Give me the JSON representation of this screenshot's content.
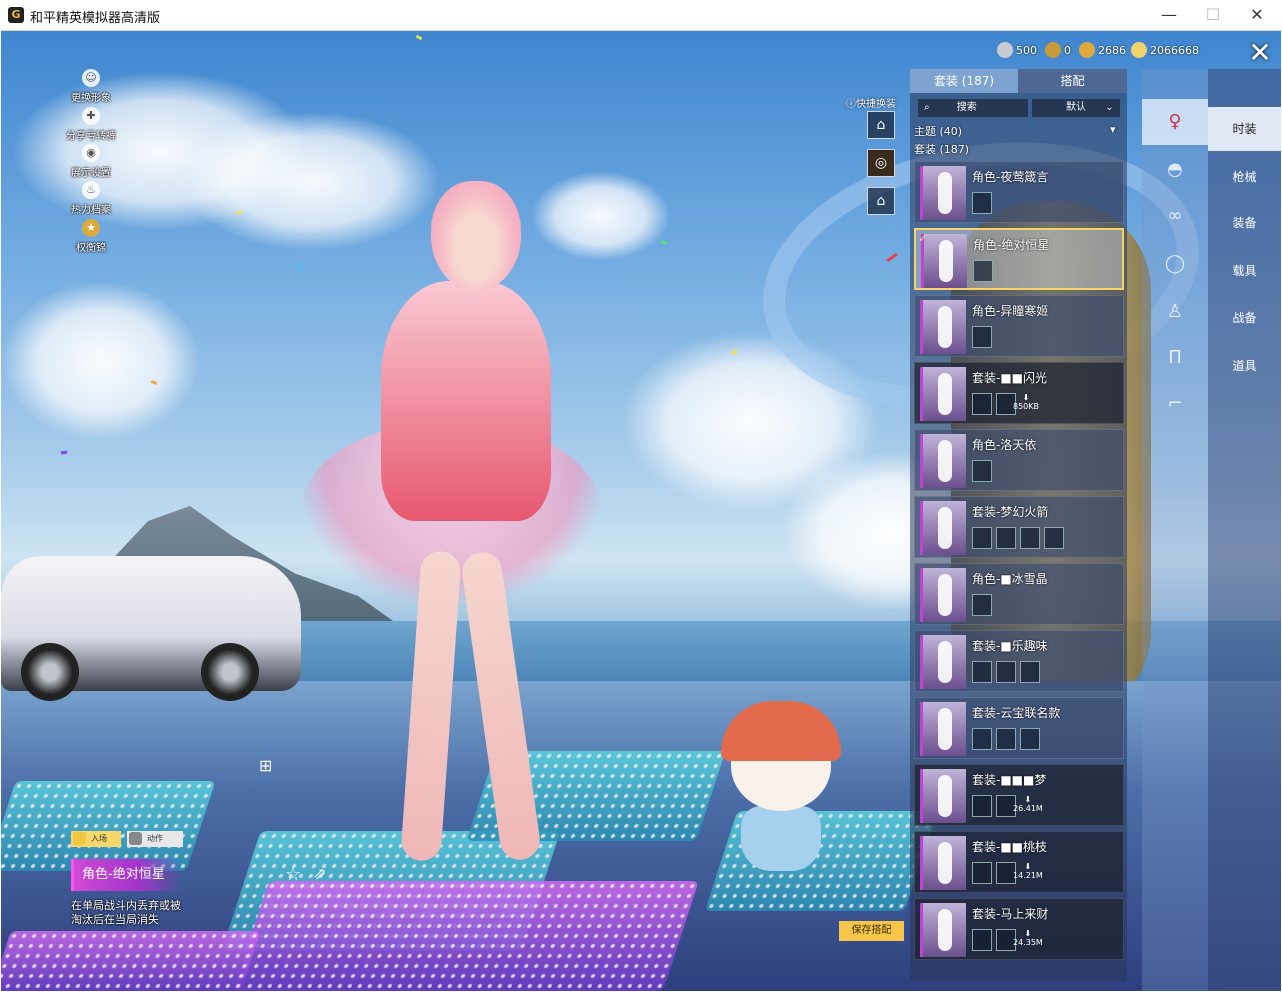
{
  "window": {
    "title": "和平精英模拟器高清版",
    "controls": [
      "—",
      "☐",
      "✕"
    ]
  },
  "currencies": [
    {
      "icon": "silver-coin-icon",
      "value": "500",
      "color": "#c8cbd2"
    },
    {
      "icon": "bronze-coin-icon",
      "value": "0",
      "color": "#c79a3a"
    },
    {
      "icon": "gold-coin-icon",
      "value": "2686",
      "color": "#e0a93b"
    },
    {
      "icon": "points-coin-icon",
      "value": "2066668",
      "color": "#f1d36a"
    }
  ],
  "left_menu": [
    {
      "icon": "person-icon",
      "label": "更换形象"
    },
    {
      "icon": "share-icon",
      "label": "分享亏转裤"
    },
    {
      "icon": "eye-icon",
      "label": "展示设置"
    },
    {
      "icon": "flame-icon",
      "label": "热力档案"
    },
    {
      "icon": "badge-icon",
      "label": "权衡锦"
    }
  ],
  "quick_change": {
    "label": "快捷换装",
    "slot_number": "2"
  },
  "panel": {
    "tabs": [
      "套装 (187)",
      "搭配"
    ],
    "search_label": "搜索",
    "sort_label": "默认",
    "category_theme": "主题 (40)",
    "category_suit": "套装 (187)",
    "items": [
      {
        "name": "角色-夜莺箴言",
        "state": "normal",
        "sub_count": 1,
        "download": ""
      },
      {
        "name": "角色-绝对恒星",
        "state": "selected",
        "sub_count": 1,
        "download": ""
      },
      {
        "name": "角色-异瞳寒姬",
        "state": "normal",
        "sub_count": 1,
        "download": ""
      },
      {
        "name": "套装-■■闪光",
        "state": "locked",
        "sub_count": 2,
        "download": "850KB"
      },
      {
        "name": "角色-洛天依",
        "state": "normal",
        "sub_count": 1,
        "download": ""
      },
      {
        "name": "套装-梦幻火箭",
        "state": "normal",
        "sub_count": 4,
        "download": ""
      },
      {
        "name": "角色-■冰雪晶",
        "state": "normal",
        "sub_count": 1,
        "download": ""
      },
      {
        "name": "套装-■乐趣味",
        "state": "normal",
        "sub_count": 3,
        "download": ""
      },
      {
        "name": "套装-云宝联名款",
        "state": "normal",
        "sub_count": 3,
        "download": ""
      },
      {
        "name": "套装-■■■梦",
        "state": "locked",
        "sub_count": 2,
        "download": "26.41M"
      },
      {
        "name": "套装-■■桃枝",
        "state": "locked",
        "sub_count": 2,
        "download": "14.21M"
      },
      {
        "name": "套装-马上来财",
        "state": "locked",
        "sub_count": 2,
        "download": "24.35M"
      }
    ]
  },
  "rail_icons": [
    "figure-icon",
    "helmet-icon",
    "goggles-icon",
    "mask-icon",
    "body-icon",
    "pants-icon",
    "shoes-icon"
  ],
  "right_nav": [
    "时装",
    "枪械",
    "装备",
    "载具",
    "战备",
    "道具"
  ],
  "bottom_info": {
    "chip_enter": "入场",
    "chip_action": "动作",
    "outfit_name": "角色-绝对恒星",
    "note_line1": "在单局战斗内丢弃或被",
    "note_line2": "淘汰后在当局消失"
  },
  "save_button": "保存搭配",
  "accent_colors": {
    "selected_border": "#f5d26c",
    "outfit_magenta": "#c043d6",
    "save_yellow": "#f6c64b"
  }
}
